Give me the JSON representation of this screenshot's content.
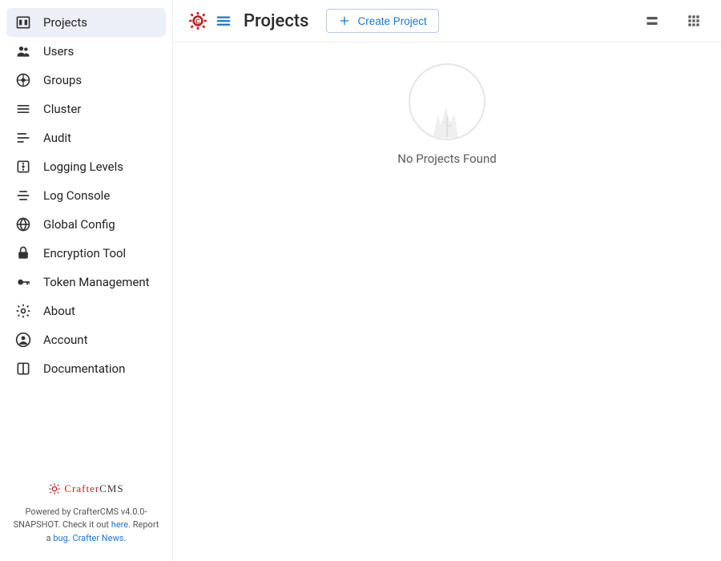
{
  "sidebar": {
    "items": [
      {
        "label": "Projects",
        "icon": "dashboard",
        "active": true
      },
      {
        "label": "Users",
        "icon": "users",
        "active": false
      },
      {
        "label": "Groups",
        "icon": "groups",
        "active": false
      },
      {
        "label": "Cluster",
        "icon": "cluster",
        "active": false
      },
      {
        "label": "Audit",
        "icon": "audit",
        "active": false
      },
      {
        "label": "Logging Levels",
        "icon": "logging-levels",
        "active": false
      },
      {
        "label": "Log Console",
        "icon": "log-console",
        "active": false
      },
      {
        "label": "Global Config",
        "icon": "globe",
        "active": false
      },
      {
        "label": "Encryption Tool",
        "icon": "lock",
        "active": false
      },
      {
        "label": "Token Management",
        "icon": "key",
        "active": false
      },
      {
        "label": "About",
        "icon": "gear",
        "active": false
      },
      {
        "label": "Account",
        "icon": "account",
        "active": false
      },
      {
        "label": "Documentation",
        "icon": "book",
        "active": false
      }
    ]
  },
  "footer": {
    "brand1": "Crafter",
    "brand2": "CMS",
    "powered_prefix": "Powered by CrafterCMS v4.0.0-SNAPSHOT. Check it out ",
    "here": "here",
    "powered_mid": ". Report a ",
    "bug": "bug",
    "sep": ". ",
    "news": "Crafter News",
    "end": "."
  },
  "header": {
    "title": "Projects",
    "create_label": "Create Project"
  },
  "empty": {
    "text": "No Projects Found"
  },
  "colors": {
    "accent_red": "#c21f1f",
    "primary_blue": "#1976d2"
  }
}
